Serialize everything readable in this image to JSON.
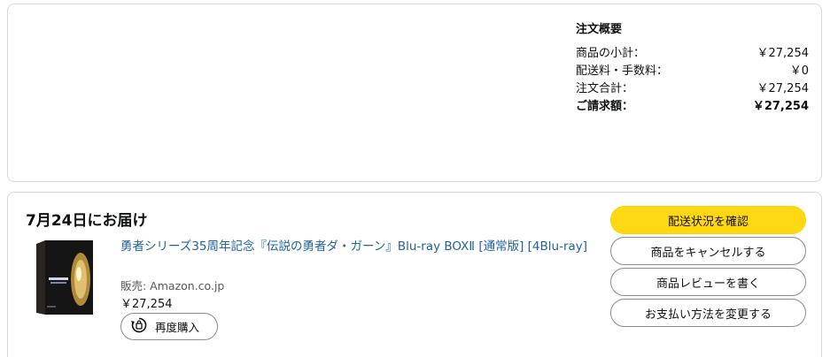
{
  "summary": {
    "title": "注文概要",
    "rows": [
      {
        "label": "商品の小計：",
        "value": "￥27,254"
      },
      {
        "label": "配送料・手数料：",
        "value": "￥0"
      },
      {
        "label": "注文合計：",
        "value": "￥27,254"
      },
      {
        "label": "ご請求額：",
        "value": "￥27,254"
      }
    ]
  },
  "delivery": {
    "title": "7月24日にお届け",
    "product": {
      "title": "勇者シリーズ35周年記念『伝説の勇者ダ・ガーン』Blu-ray BOXⅡ [通常版] [4Blu-ray]",
      "seller": "販売: Amazon.co.jp",
      "price": "￥27,254",
      "buy_again_label": "再度購入"
    },
    "actions": {
      "track": "配送状況を確認",
      "cancel": "商品をキャンセルする",
      "review": "商品レビューを書く",
      "change_payment": "お支払い方法を変更する"
    }
  },
  "colors": {
    "primary_button": "#ffd814",
    "link": "#2162a1"
  }
}
